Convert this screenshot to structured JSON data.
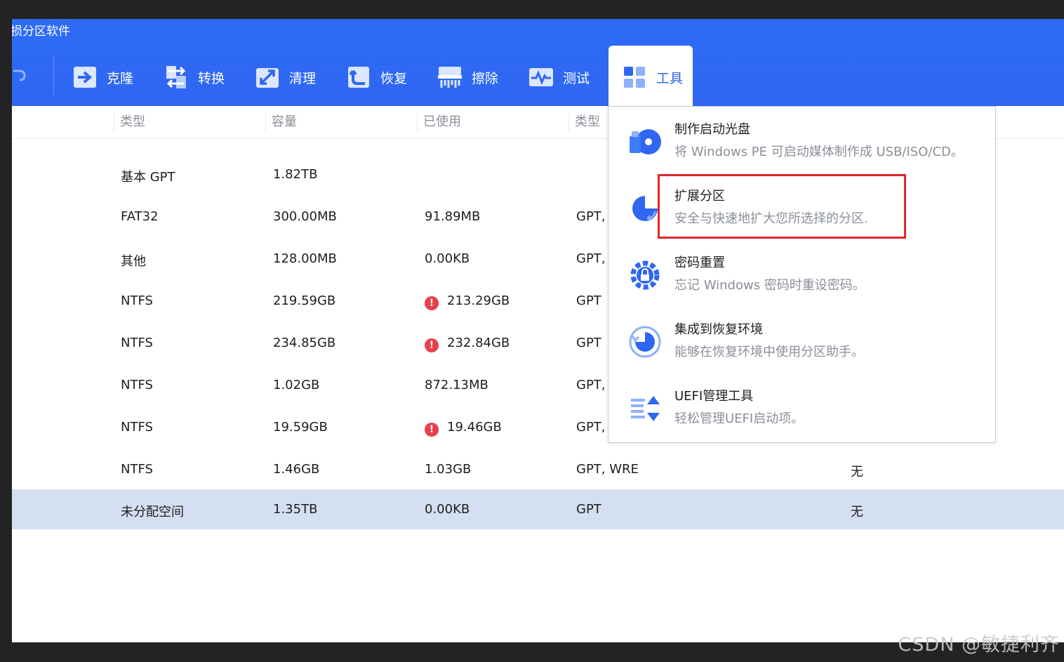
{
  "window": {
    "title": "损分区软件"
  },
  "toolbar": {
    "tools": [
      {
        "label": "克隆",
        "icon": "clone-icon"
      },
      {
        "label": "转换",
        "icon": "convert-icon"
      },
      {
        "label": "清理",
        "icon": "cleanup-icon"
      },
      {
        "label": "恢复",
        "icon": "recover-icon"
      },
      {
        "label": "擦除",
        "icon": "wipe-icon"
      },
      {
        "label": "测试",
        "icon": "test-icon"
      },
      {
        "label": "工具",
        "icon": "tools-grid-icon",
        "active": true
      }
    ]
  },
  "table": {
    "headers": [
      "类型",
      "容量",
      "已使用",
      "类型"
    ],
    "rows": [
      {
        "type": "基本 GPT",
        "capacity": "1.82TB",
        "used": "",
        "partition_type": "",
        "extra": "",
        "warn": false
      },
      {
        "type": "FAT32",
        "capacity": "300.00MB",
        "used": "91.89MB",
        "partition_type": "GPT,",
        "extra": "",
        "warn": false
      },
      {
        "type": "其他",
        "capacity": "128.00MB",
        "used": "0.00KB",
        "partition_type": "GPT,",
        "extra": "",
        "warn": false
      },
      {
        "type": "NTFS",
        "capacity": "219.59GB",
        "used": "213.29GB",
        "partition_type": "GPT",
        "extra": "",
        "warn": true
      },
      {
        "type": "NTFS",
        "capacity": "234.85GB",
        "used": "232.84GB",
        "partition_type": "GPT",
        "extra": "",
        "warn": true
      },
      {
        "type": "NTFS",
        "capacity": "1.02GB",
        "used": "872.13MB",
        "partition_type": "GPT,",
        "extra": "",
        "warn": false
      },
      {
        "type": "NTFS",
        "capacity": "19.59GB",
        "used": "19.46GB",
        "partition_type": "GPT,",
        "extra": "",
        "warn": true
      },
      {
        "type": "NTFS",
        "capacity": "1.46GB",
        "used": "1.03GB",
        "partition_type": "GPT, WRE",
        "extra": "无",
        "warn": false
      },
      {
        "type": "未分配空间",
        "capacity": "1.35TB",
        "used": "0.00KB",
        "partition_type": "GPT",
        "extra": "无",
        "warn": false,
        "selected": true
      }
    ],
    "warn_symbol": "!"
  },
  "tools_menu": {
    "items": [
      {
        "title": "制作启动光盘",
        "desc": "将 Windows PE 可启动媒体制作成 USB/ISO/CD。",
        "icon": "bootable-media-icon"
      },
      {
        "title": "扩展分区",
        "desc": "安全与快速地扩大您所选择的分区.",
        "icon": "extend-partition-icon",
        "highlighted": true
      },
      {
        "title": "密码重置",
        "desc": "忘记 Windows 密码时重设密码。",
        "icon": "password-reset-icon"
      },
      {
        "title": "集成到恢复环境",
        "desc": "能够在恢复环境中使用分区助手。",
        "icon": "recovery-environment-icon"
      },
      {
        "title": "UEFI管理工具",
        "desc": "轻松管理UEFI启动项。",
        "icon": "uefi-manager-icon"
      }
    ]
  },
  "watermark": "CSDN @敏捷利齐",
  "colors": {
    "brand_blue": "#2f66f2",
    "selected_row": "#d4e0f1",
    "highlight_red": "#e0262a",
    "warning_red": "#e8404a"
  }
}
